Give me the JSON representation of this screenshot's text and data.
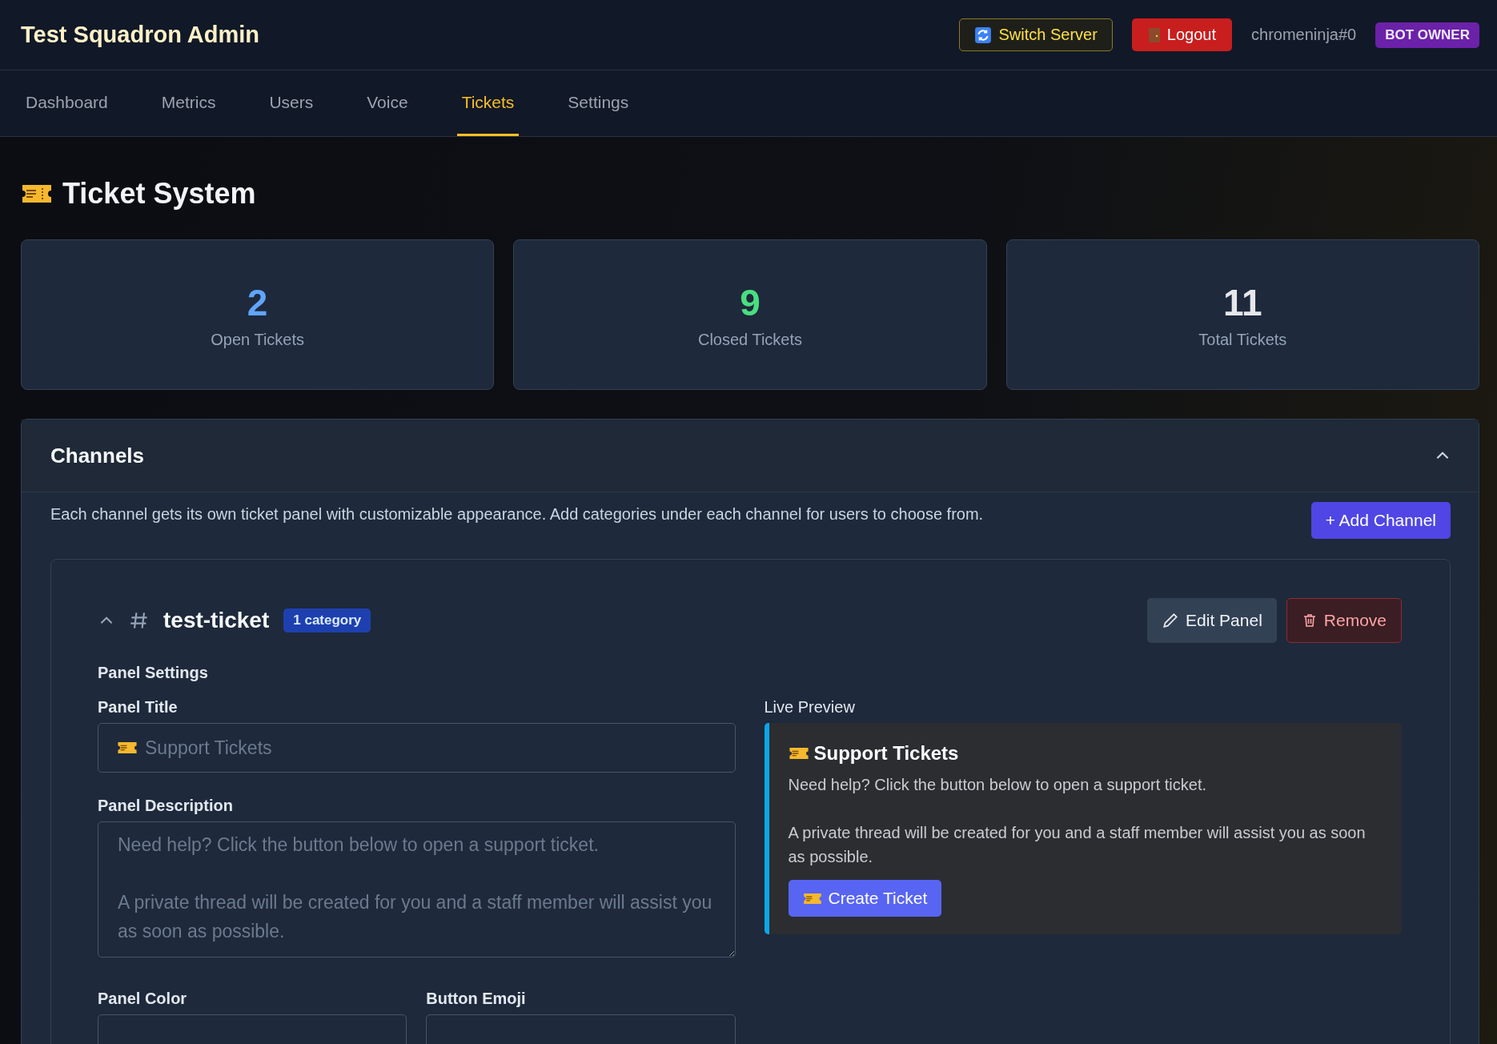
{
  "header": {
    "title": "Test Squadron Admin",
    "switch_server": "Switch Server",
    "logout": "Logout",
    "user": "chromeninja#0",
    "role_badge": "BOT OWNER"
  },
  "tabs": [
    {
      "label": "Dashboard",
      "selected": false
    },
    {
      "label": "Metrics",
      "selected": false
    },
    {
      "label": "Users",
      "selected": false
    },
    {
      "label": "Voice",
      "selected": false
    },
    {
      "label": "Tickets",
      "selected": true
    },
    {
      "label": "Settings",
      "selected": false
    }
  ],
  "page_title": "Ticket System",
  "stats": [
    {
      "value": "2",
      "label": "Open Tickets",
      "color": "#60a5fa"
    },
    {
      "value": "9",
      "label": "Closed Tickets",
      "color": "#4ade80"
    },
    {
      "value": "11",
      "label": "Total Tickets",
      "color": "#e5e7eb"
    }
  ],
  "channels_section": {
    "title": "Channels",
    "expanded": true,
    "description": "Each channel gets its own ticket panel with customizable appearance. Add categories under each channel for users to choose from.",
    "add_button": "+ Add Channel",
    "channels": [
      {
        "name": "test-ticket",
        "badge": "1 category",
        "expanded": true,
        "edit_button": "Edit Panel",
        "remove_button": "Remove",
        "settings_heading": "Panel Settings",
        "panel_title": {
          "label": "Panel Title",
          "placeholder": "Support Tickets"
        },
        "panel_description": {
          "label": "Panel Description",
          "placeholder": "Need help? Click the button below to open a support ticket.\n\nA private thread will be created for you and a staff member will assist you as soon as possible."
        },
        "panel_color": {
          "label": "Panel Color"
        },
        "button_emoji": {
          "label": "Button Emoji"
        },
        "preview": {
          "label": "Live Preview",
          "title": "Support Tickets",
          "description": "Need help? Click the button below to open a support ticket.\n\nA private thread will be created for you and a staff member will assist you as soon as possible.",
          "button": "Create Ticket"
        }
      }
    ]
  }
}
